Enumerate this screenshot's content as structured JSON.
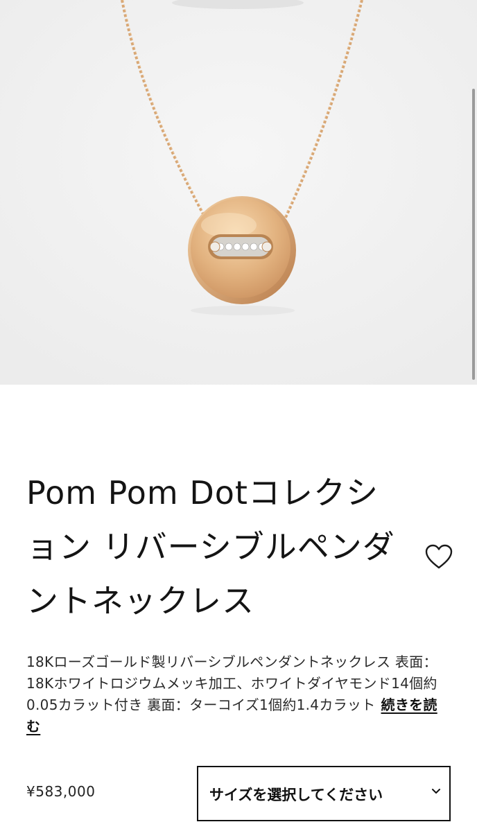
{
  "product": {
    "image_alt": "Pom Pom Dot pendant necklace",
    "title": "Pom Pom Dotコレクション リバーシブルペンダントネックレス",
    "description": "18Kローズゴールド製リバーシブルペンダントネックレス 表面：18Kホワイトロジウムメッキ加工、ホワイトダイヤモンド14個約0.05カラット付き 裏面：ターコイズ1個約1.4カラット",
    "read_more_label": "続きを読む",
    "price": "¥583,000",
    "size_select_label": "サイズを選択してください"
  },
  "icons": {
    "favorite": "heart-outline-icon",
    "dropdown": "chevron-down-icon"
  },
  "colors": {
    "hero_background": "#f2f2f2",
    "gold": "#e0b07f",
    "text": "#1a1a1a"
  }
}
